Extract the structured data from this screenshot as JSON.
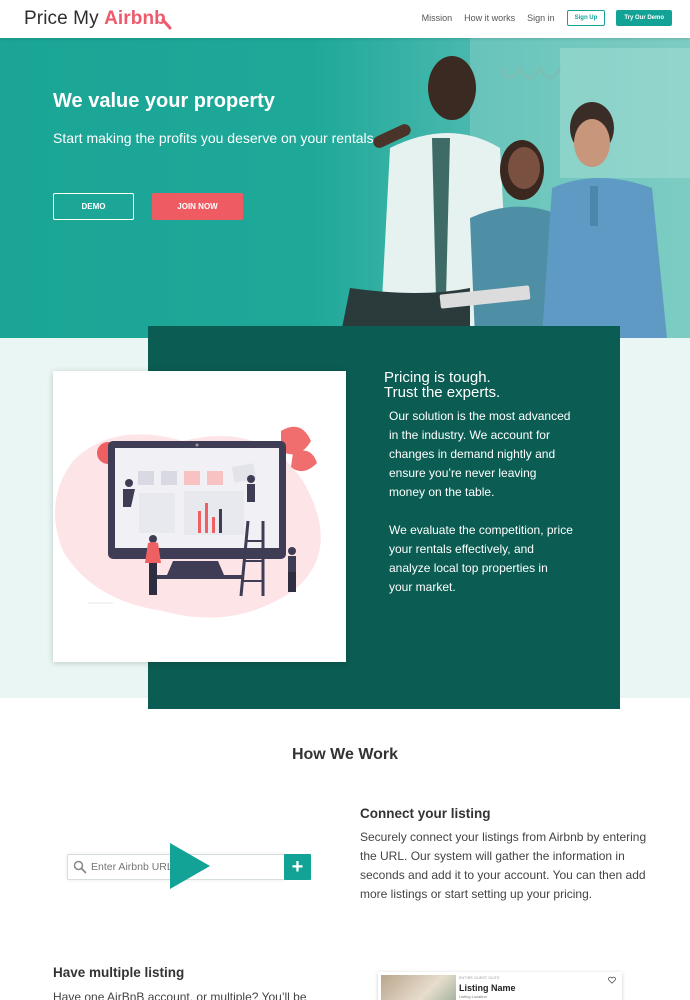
{
  "nav": {
    "logo_part1": "Price My ",
    "logo_part2": "Airbnb",
    "links": [
      "Mission",
      "How it works",
      "Sign in"
    ],
    "signup_label": "Sign Up",
    "demo_label": "Try Our Demo"
  },
  "hero": {
    "title": "We value your property",
    "subtitle": "Start making the profits you deserve on your rentals",
    "demo_button": "DEMO",
    "join_button": "JOIN NOW"
  },
  "pricing": {
    "heading_line1": "Pricing is tough.",
    "heading_line2": "Trust the experts.",
    "paragraph1": "Our solution is the most advanced in the industry. We account for changes in demand nightly and ensure you’re never leaving money on the table.",
    "paragraph2": "We evaluate the competition, price your rentals effectively, and analyze local top properties in your market."
  },
  "how": {
    "title": "How We Work",
    "search_placeholder": "Enter Airbnb URL",
    "plus_label": "+",
    "connect_title": "Connect your listing",
    "connect_body": "Securely connect your listings from Airbnb by entering the URL. Our system will gather the information in seconds and add it to your account. You can then add more listings or start setting up your pricing.",
    "multi_title": "Have multiple listing",
    "multi_body": "Have one AirBnB account, or multiple? You’ll be",
    "listing_kicker": "ENTIRE GUEST SUITE",
    "listing_name": "Listing Name",
    "listing_location": "Listing Location"
  },
  "colors": {
    "accent": "#13a396",
    "brand": "#ee5a6b",
    "dark_teal": "#0b5c52",
    "light_teal": "#e9f6f4"
  }
}
